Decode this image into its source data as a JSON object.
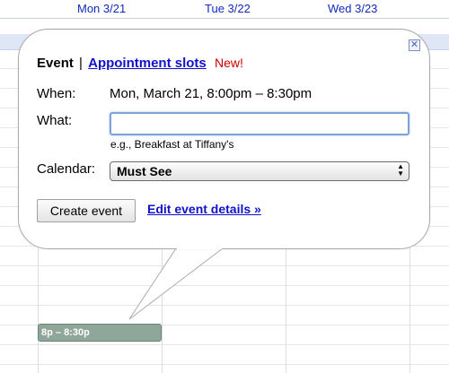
{
  "calendar": {
    "day_headers": [
      "Mon 3/21",
      "Tue 3/22",
      "Wed 3/23"
    ],
    "event_chip_label": "8p – 8:30p",
    "event_chip_color": "#8fa69a"
  },
  "bubble": {
    "close_symbol": "✕",
    "tabs": {
      "event_label": "Event",
      "separator": "|",
      "appointment_label": "Appointment slots",
      "new_badge": "New!"
    },
    "when_label": "When:",
    "when_value": "Mon, March 21, 8:00pm – 8:30pm",
    "what_label": "What:",
    "what_value": "",
    "what_hint": "e.g., Breakfast at Tiffany's",
    "calendar_label": "Calendar:",
    "calendar_selected": "Must See",
    "create_button": "Create event",
    "edit_link": "Edit event details »"
  },
  "colors": {
    "link": "#1111cc",
    "new_badge": "#cc0000",
    "header_text": "#112abb",
    "allday_band": "#dfe7f7"
  },
  "icons": {
    "close": "close-icon",
    "select_arrows": "select-arrows-icon"
  }
}
